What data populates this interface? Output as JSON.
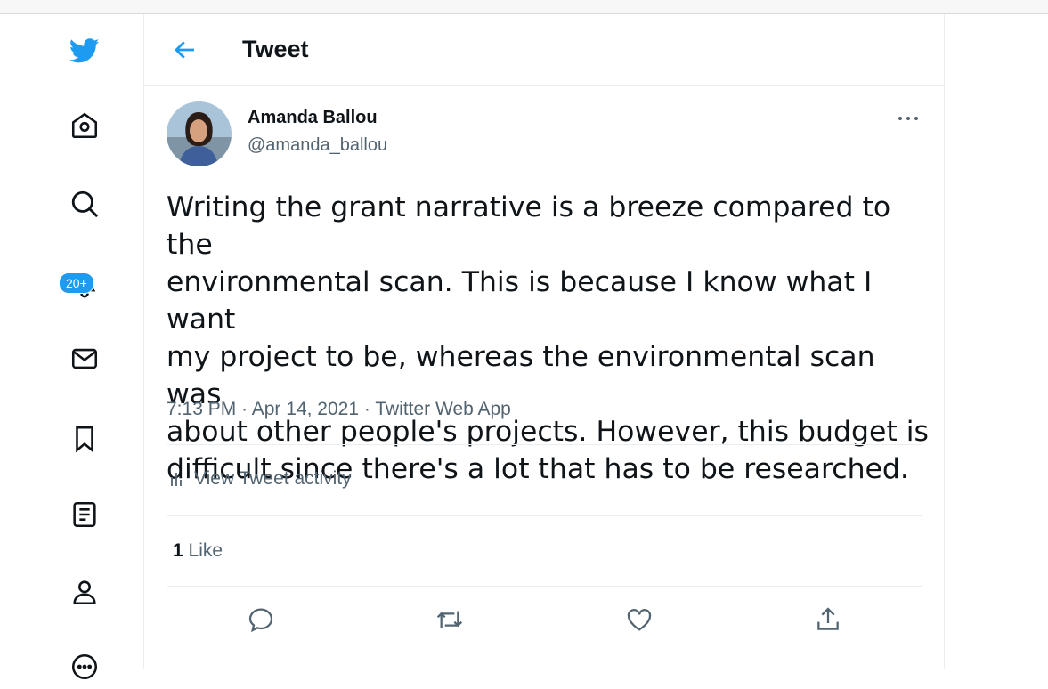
{
  "header": {
    "title": "Tweet"
  },
  "nav": {
    "items": [
      {
        "icon": "twitter-logo-icon"
      },
      {
        "icon": "home-icon"
      },
      {
        "icon": "explore-icon"
      },
      {
        "icon": "notifications-icon",
        "badge": "20+"
      },
      {
        "icon": "messages-icon"
      },
      {
        "icon": "bookmarks-icon"
      },
      {
        "icon": "lists-icon"
      },
      {
        "icon": "profile-icon"
      },
      {
        "icon": "more-icon"
      }
    ]
  },
  "tweet": {
    "author_name": "Amanda Ballou",
    "author_handle": "@amanda_ballou",
    "text": "Writing the grant narrative is a breeze compared to the\nenvironmental scan. This is because I know what I want\nmy project to be, whereas the environmental scan was\nabout other people's projects. However, this budget is\ndifficult since there's a lot that has to be researched.",
    "time": "7:13 PM",
    "date": "Apr 14, 2021",
    "source": "Twitter Web App",
    "separator": "·",
    "activity_label": "View Tweet activity",
    "like_count": "1",
    "like_label": "Like"
  },
  "colors": {
    "accent": "#1d9bf0",
    "text": "#0f1419",
    "muted": "#536471",
    "border": "#ebeef0"
  }
}
